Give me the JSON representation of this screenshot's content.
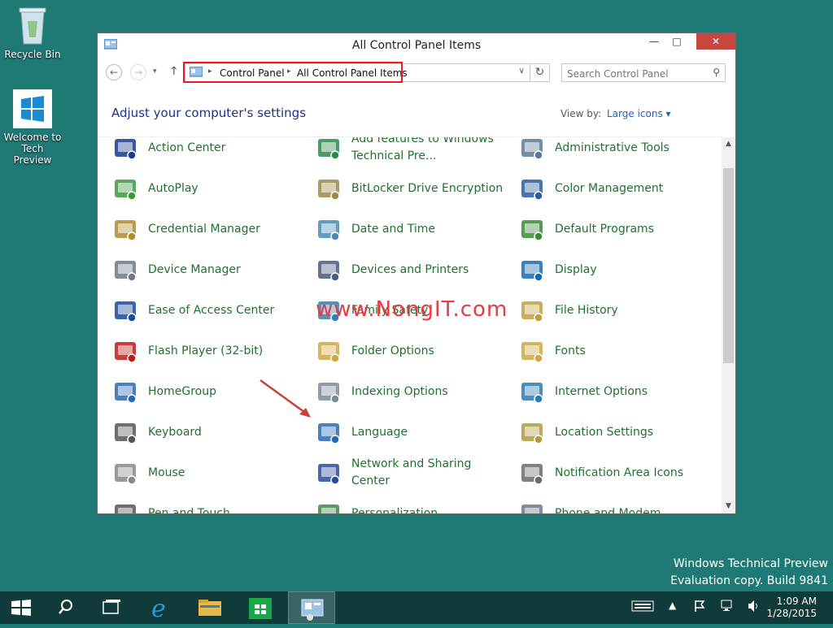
{
  "desktop": {
    "recycle_bin": "Recycle Bin",
    "welcome": "Welcome to Tech Preview"
  },
  "watermark": {
    "line1": "Windows Technical Preview",
    "line2": "Evaluation copy. Build 9841"
  },
  "window": {
    "title": "All Control Panel Items",
    "min": "—",
    "max": "□",
    "close": "✕"
  },
  "nav": {
    "back": "←",
    "forward": "→",
    "recent": "▾",
    "up": "↑",
    "breadcrumb": [
      "Control Panel",
      "All Control Panel Items"
    ],
    "dropdown": "∨",
    "refresh": "↻",
    "search_placeholder": "Search Control Panel"
  },
  "header": {
    "title": "Adjust your computer's settings",
    "view_by_label": "View by:",
    "view_by_value": "Large icons ▾"
  },
  "items": [
    {
      "label": "Action Center",
      "icon": "flag-icon",
      "color": "#1a3a8f"
    },
    {
      "label": "Add features to Windows Technical Pre...",
      "icon": "add-features-icon",
      "color": "#2a8a4a",
      "two": true
    },
    {
      "label": "Administrative Tools",
      "icon": "admin-tools-icon",
      "color": "#5a7a9a"
    },
    {
      "label": "AutoPlay",
      "icon": "autoplay-icon",
      "color": "#3a9a3a"
    },
    {
      "label": "BitLocker Drive Encryption",
      "icon": "bitlocker-icon",
      "color": "#9a8a4a"
    },
    {
      "label": "Color Management",
      "icon": "color-management-icon",
      "color": "#2a5aa0"
    },
    {
      "label": "Credential Manager",
      "icon": "credential-icon",
      "color": "#b08a30"
    },
    {
      "label": "Date and Time",
      "icon": "clock-icon",
      "color": "#4a8ab0"
    },
    {
      "label": "Default Programs",
      "icon": "default-programs-icon",
      "color": "#3a8a3a"
    },
    {
      "label": "Device Manager",
      "icon": "device-manager-icon",
      "color": "#6a7a8a"
    },
    {
      "label": "Devices and Printers",
      "icon": "printer-icon",
      "color": "#4a5a7a"
    },
    {
      "label": "Display",
      "icon": "display-icon",
      "color": "#1a6ab0"
    },
    {
      "label": "Ease of Access Center",
      "icon": "ease-of-access-icon",
      "color": "#1a4a9a"
    },
    {
      "label": "Family Safety",
      "icon": "family-safety-icon",
      "color": "#3a7ab0"
    },
    {
      "label": "File History",
      "icon": "file-history-icon",
      "color": "#c0a040"
    },
    {
      "label": "Flash Player (32-bit)",
      "icon": "flash-icon",
      "color": "#c01a1a"
    },
    {
      "label": "Folder Options",
      "icon": "folder-options-icon",
      "color": "#d0a840"
    },
    {
      "label": "Fonts",
      "icon": "fonts-icon",
      "color": "#d0a840"
    },
    {
      "label": "HomeGroup",
      "icon": "homegroup-icon",
      "color": "#2a6ab0"
    },
    {
      "label": "Indexing Options",
      "icon": "indexing-icon",
      "color": "#7a8a9a"
    },
    {
      "label": "Internet Options",
      "icon": "internet-options-icon",
      "color": "#2a7ab0"
    },
    {
      "label": "Keyboard",
      "icon": "keyboard-icon",
      "color": "#555555"
    },
    {
      "label": "Language",
      "icon": "language-icon",
      "color": "#2a6ab0"
    },
    {
      "label": "Location Settings",
      "icon": "location-icon",
      "color": "#b09a40"
    },
    {
      "label": "Mouse",
      "icon": "mouse-icon",
      "color": "#888888"
    },
    {
      "label": "Network and Sharing Center",
      "icon": "network-icon",
      "color": "#2a4a9a",
      "two": true
    },
    {
      "label": "Notification Area Icons",
      "icon": "notification-icon",
      "color": "#6a6a6a"
    },
    {
      "label": "Pen and Touch",
      "icon": "pen-icon",
      "color": "#555555"
    },
    {
      "label": "Personalization",
      "icon": "personalization-icon",
      "color": "#3a8a4a"
    },
    {
      "label": "Phone and Modem",
      "icon": "phone-icon",
      "color": "#6a7a8a"
    }
  ],
  "annotation": {
    "watermark_text": "www.NongIT.com"
  },
  "taskbar": {
    "time": "1:09 AM",
    "date": "1/28/2015"
  }
}
